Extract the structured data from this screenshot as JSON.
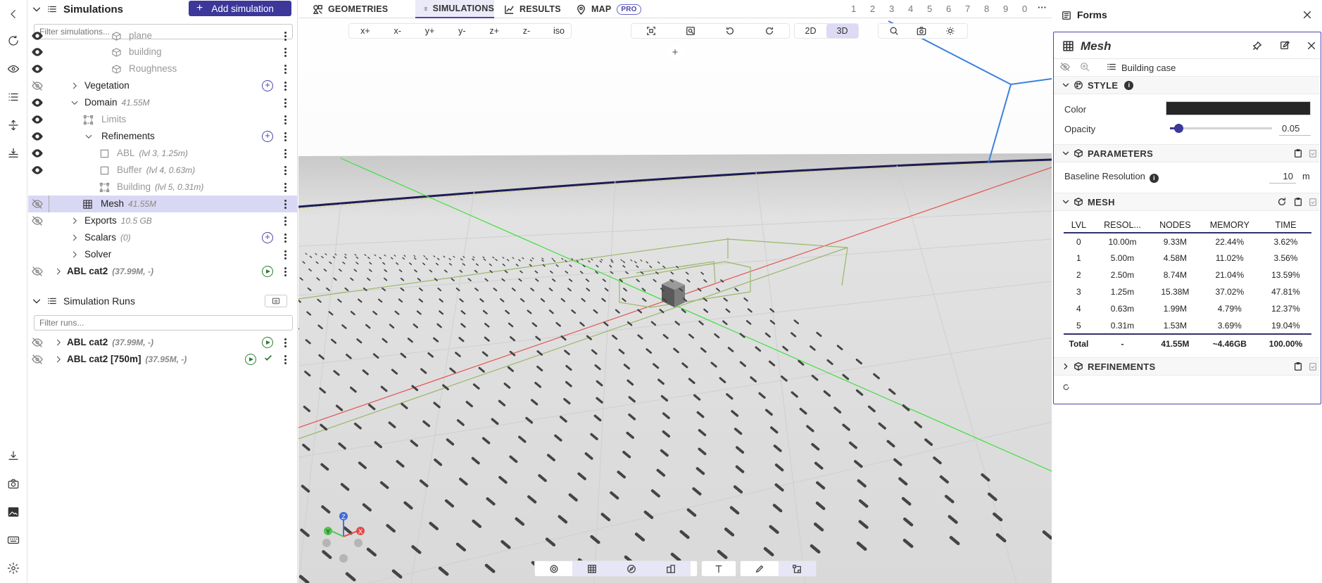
{
  "rail": {
    "icons": [
      "back-icon",
      "refresh-icon",
      "eye-icon",
      "list-icon",
      "align-vertical-icon",
      "align-bottom-icon",
      "download-icon",
      "camera-icon",
      "image-icon",
      "keyboard-icon",
      "settings-icon"
    ]
  },
  "sidebar": {
    "title": "Simulations",
    "add_label": "Add simulation",
    "filter_placeholder": "Filter simulations...",
    "tree": [
      {
        "label": "plane",
        "meta": "",
        "dim": true
      },
      {
        "label": "building",
        "meta": "",
        "dim": true
      },
      {
        "label": "Roughness",
        "meta": "",
        "dim": true
      },
      {
        "label": "Vegetation",
        "meta": ""
      },
      {
        "label": "Domain",
        "meta": "41.55M"
      },
      {
        "label": "Limits",
        "meta": "",
        "dim": true
      },
      {
        "label": "Refinements",
        "meta": ""
      },
      {
        "label": "ABL",
        "meta": "(lvl 3, 1.25m)",
        "dim": true
      },
      {
        "label": "Buffer",
        "meta": "(lvl 4, 0.63m)",
        "dim": true
      },
      {
        "label": "Building",
        "meta": "(lvl 5, 0.31m)",
        "dim": true
      },
      {
        "label": "Mesh",
        "meta": "41.55M",
        "selected": true
      },
      {
        "label": "Exports",
        "meta": "10.5 GB"
      },
      {
        "label": "Scalars",
        "meta": "(0)"
      },
      {
        "label": "Solver",
        "meta": ""
      },
      {
        "label": "ABL cat2",
        "meta": "(37.99M, -)",
        "bold": true
      }
    ],
    "runs_title": "Simulation Runs",
    "runs_filter_placeholder": "Filter runs...",
    "runs": [
      {
        "label": "ABL cat2",
        "meta": "(37.99M, -)"
      },
      {
        "label": "ABL cat2 [750m]",
        "meta": "(37.95M, -)"
      }
    ]
  },
  "tabs": [
    {
      "label": "GEOMETRIES",
      "icon": "shapes-icon",
      "active": false
    },
    {
      "label": "SIMULATIONS",
      "icon": "list-icon",
      "active": true
    },
    {
      "label": "RESULTS",
      "icon": "chart-icon",
      "active": false
    },
    {
      "label": "MAP",
      "icon": "map-pin-icon",
      "active": false,
      "badge": "PRO"
    }
  ],
  "numbers": [
    "1",
    "2",
    "3",
    "4",
    "5",
    "6",
    "7",
    "8",
    "9",
    "0"
  ],
  "more": "···",
  "viewbar": {
    "axes": [
      "x+",
      "x-",
      "y+",
      "y-",
      "z+",
      "z-",
      "iso"
    ],
    "mode_2d": "2D",
    "mode_3d": "3D"
  },
  "gizmo": {
    "z": "Z",
    "y": "Y",
    "x": "X"
  },
  "plus": "+",
  "right": {
    "title": "Forms",
    "card_title": "Mesh",
    "breadcrumb": "Building case",
    "style": {
      "title": "STYLE",
      "color_label": "Color",
      "color_value": "#262626",
      "opacity_label": "Opacity",
      "opacity_value": "0.05",
      "opacity_fraction": 0.05
    },
    "parameters": {
      "title": "PARAMETERS",
      "baseline_label": "Baseline Resolution",
      "baseline_value": "10",
      "unit": "m"
    },
    "mesh": {
      "title": "MESH",
      "headers": [
        "LVL",
        "RESOL...",
        "NODES",
        "MEMORY",
        "TIME"
      ],
      "rows": [
        [
          "0",
          "10.00m",
          "9.33M",
          "22.44%",
          "3.62%"
        ],
        [
          "1",
          "5.00m",
          "4.58M",
          "11.02%",
          "3.56%"
        ],
        [
          "2",
          "2.50m",
          "8.74M",
          "21.04%",
          "13.59%"
        ],
        [
          "3",
          "1.25m",
          "15.38M",
          "37.02%",
          "47.81%"
        ],
        [
          "4",
          "0.63m",
          "1.99M",
          "4.79%",
          "12.37%"
        ],
        [
          "5",
          "0.31m",
          "1.53M",
          "3.69%",
          "19.04%"
        ]
      ],
      "total": [
        "Total",
        "-",
        "41.55M",
        "~4.46GB",
        "100.00%"
      ]
    },
    "refinements": {
      "title": "REFINEMENTS"
    }
  }
}
